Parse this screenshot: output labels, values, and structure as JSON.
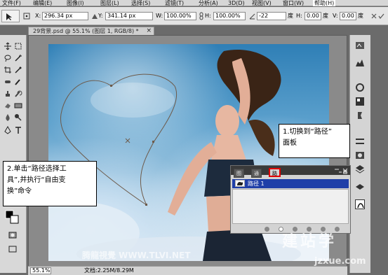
{
  "menubar": {
    "items": [
      "文件(F)",
      "编辑(E)",
      "图像(I)",
      "图层(L)",
      "选择(S)",
      "滤镜(T)",
      "分析(A)",
      "3D(D)",
      "视图(V)",
      "窗口(W)",
      "帮助(H)"
    ]
  },
  "options": {
    "x_label": "X:",
    "x_value": "296.34 px",
    "y_label": "Y:",
    "y_value": "341.14 px",
    "w_label": "W:",
    "w_value": "100.00%",
    "h_label": "H:",
    "h_value": "100.00%",
    "rot_value": "-22",
    "rot_unit": "度",
    "hskew_label": "H:",
    "hskew_value": "0.00",
    "hskew_unit": "度",
    "vskew_label": "V:",
    "vskew_value": "0.00",
    "vskew_unit": "度"
  },
  "document": {
    "tab_title": "29背景.psd @ 55.1% (图层 1, RGB/8) *",
    "close_glyph": "×",
    "zoom": "55.1%",
    "doc_size": "文档:2.25M/8.29M"
  },
  "callouts": {
    "left_line1": "2.单击“路径选择工",
    "left_line2": "具”,并执行“自由变",
    "left_line3": "换”命令",
    "right_line1": "1.切换到“路径”",
    "right_line2": "面板"
  },
  "paths_panel": {
    "tabs": [
      "图层",
      "通道",
      "路径"
    ],
    "active_tab": 2,
    "path_name": "路径 1"
  },
  "watermarks": {
    "site_text": "腾龍視覺 WWW.TLVI.NET",
    "logo_text": "建站学",
    "logo_url": "jzxue.com"
  },
  "colors": {
    "highlight": "#e00000",
    "selection": "#1f3fa8"
  }
}
